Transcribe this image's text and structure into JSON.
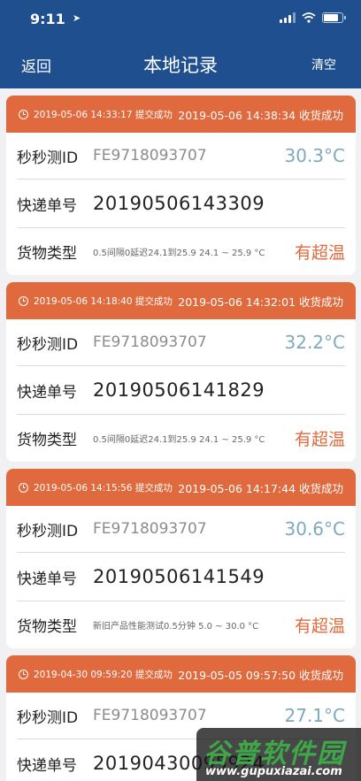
{
  "status_bar": {
    "time": "9:11",
    "location_glyph": "➤"
  },
  "nav": {
    "back_label": "返回",
    "title": "本地记录",
    "clear_label": "清空"
  },
  "labels": {
    "device": "秒秒测ID",
    "tracking": "快递单号",
    "cargo": "货物类型"
  },
  "records": [
    {
      "submit_text": "2019-05-06 14:33:17 提交成功",
      "receive_text": "2019-05-06 14:38:34 收货成功",
      "device_id": "FE9718093707",
      "temperature": "30.3°C",
      "tracking_no": "20190506143309",
      "cargo_desc": "0.5间隔0延迟24.1到25.9 24.1 ~ 25.9 °C",
      "status": "有超温"
    },
    {
      "submit_text": "2019-05-06 14:18:40 提交成功",
      "receive_text": "2019-05-06 14:32:01 收货成功",
      "device_id": "FE9718093707",
      "temperature": "32.2°C",
      "tracking_no": "20190506141829",
      "cargo_desc": "0.5间隔0延迟24.1到25.9 24.1 ~ 25.9 °C",
      "status": "有超温"
    },
    {
      "submit_text": "2019-05-06 14:15:56 提交成功",
      "receive_text": "2019-05-06 14:17:44 收货成功",
      "device_id": "FE9718093707",
      "temperature": "30.6°C",
      "tracking_no": "20190506141549",
      "cargo_desc": "新旧产品性能测试0.5分钟 5.0 ~ 30.0 °C",
      "status": "有超温"
    },
    {
      "submit_text": "2019-04-30 09:59:20 提交成功",
      "receive_text": "2019-05-05 09:57:50 收货成功",
      "device_id": "FE9718093707",
      "temperature": "27.1°C",
      "tracking_no": "20190430095924",
      "cargo_desc": "",
      "status": ""
    }
  ],
  "watermark": {
    "title": "谷普软件园",
    "url": "www.gupuxiazai.com"
  },
  "colors": {
    "nav_bg": "#1f4f8f",
    "card_header": "#e06a3e",
    "temperature": "#7fa9bd",
    "alert": "#df6a3d"
  }
}
